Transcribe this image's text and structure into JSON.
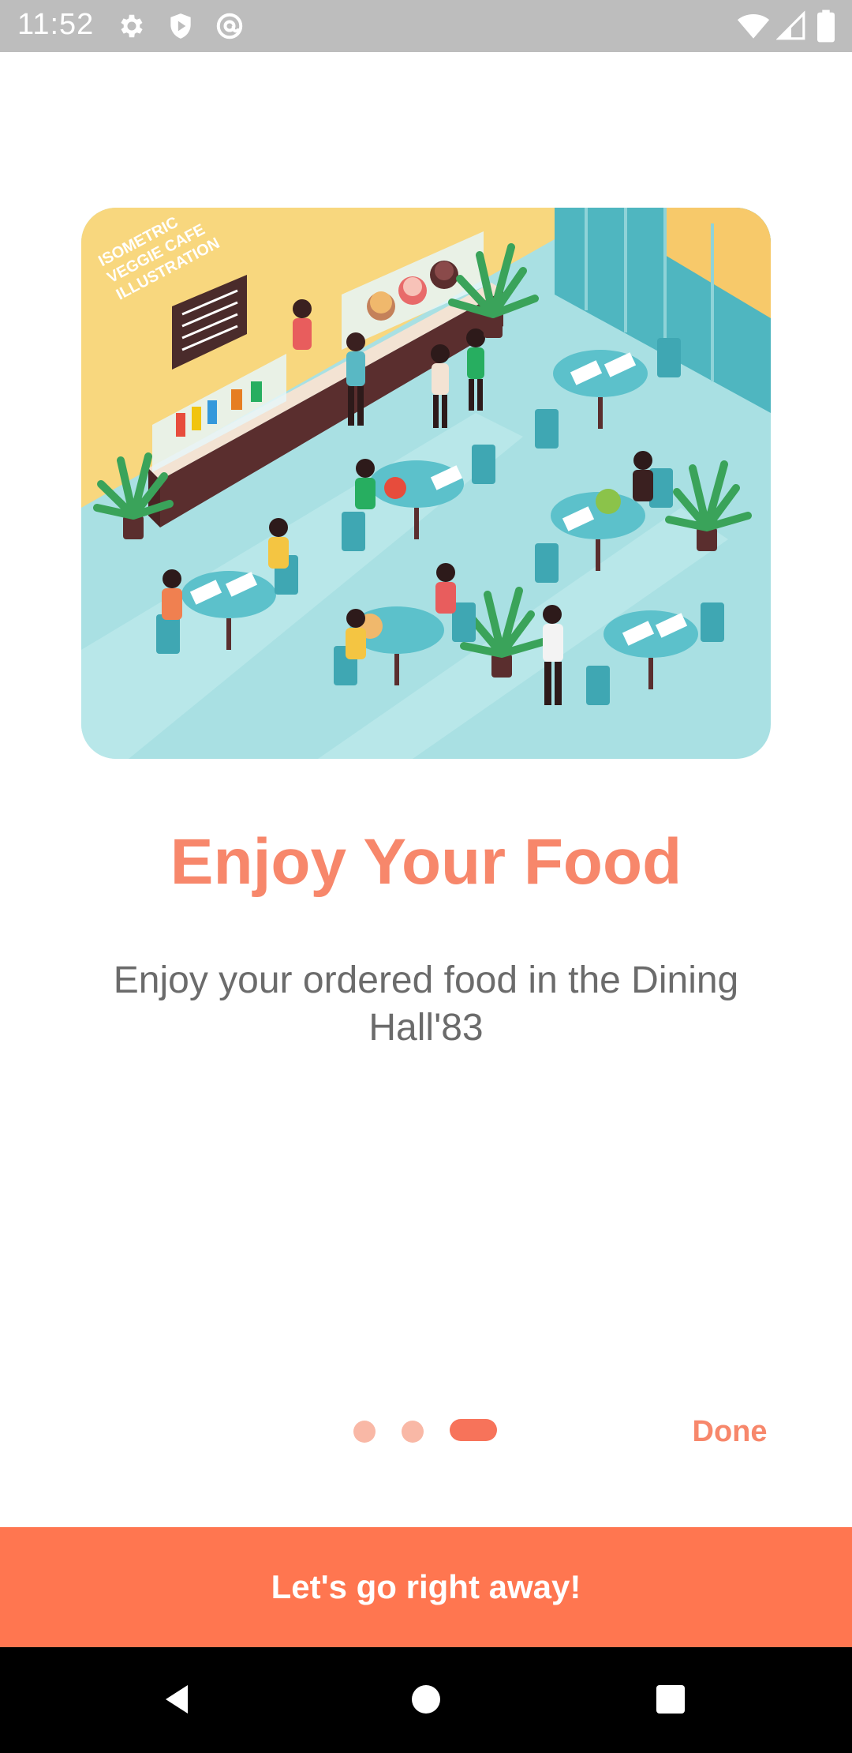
{
  "status_bar": {
    "time": "11:52",
    "left_icons": [
      "gear-icon",
      "shield-icon",
      "at-sync-icon"
    ],
    "right_icons": [
      "wifi-icon",
      "cell-signal-icon",
      "battery-icon"
    ]
  },
  "illustration": {
    "name": "cafe-illustration",
    "caption_lines": [
      "ISOMETRIC",
      "VEGGIE CAFE",
      "ILLUSTRATION"
    ]
  },
  "onboarding": {
    "title": "Enjoy Your Food",
    "subtitle": "Enjoy your ordered food in the Dining Hall'83"
  },
  "pager": {
    "total": 3,
    "active_index": 2,
    "done_label": "Done"
  },
  "cta": {
    "label": "Let's go right away!"
  },
  "colors": {
    "accent": "#f7876b",
    "button": "#ff7650",
    "dot_inactive": "#f9b8a6",
    "dot_active": "#f7735a",
    "status_bar": "#bdbdbd"
  },
  "nav_bar": {
    "buttons": [
      "back-icon",
      "home-icon",
      "recents-icon"
    ]
  }
}
